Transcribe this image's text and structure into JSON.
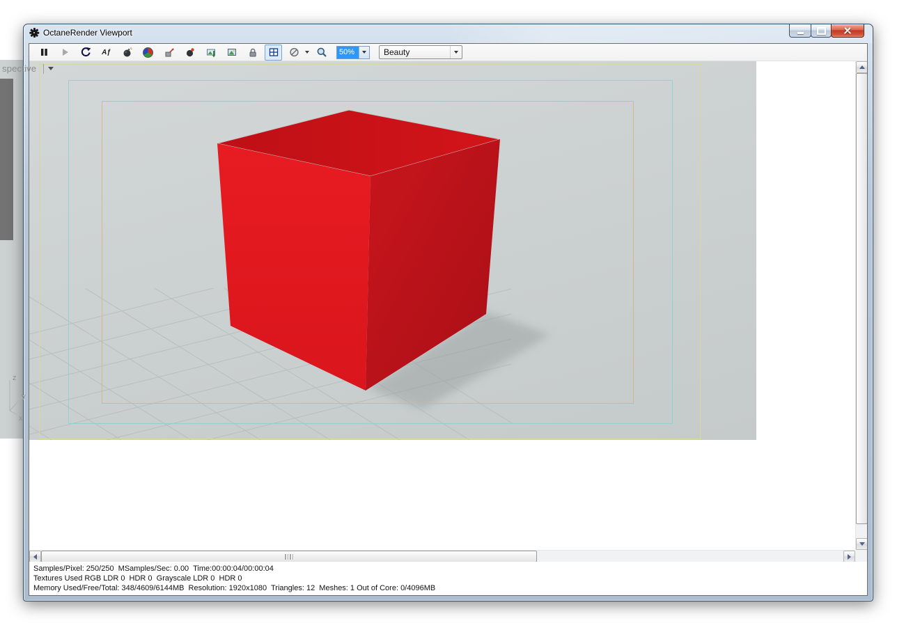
{
  "window": {
    "title": "OctaneRender Viewport"
  },
  "background_app": {
    "viewport_label": "spective",
    "axis_z": "z",
    "axis_y": "y",
    "axis_x": "x"
  },
  "toolbar": {
    "af_icon_label": "Aƒ",
    "zoom_value": "50%",
    "render_pass_value": "Beauty"
  },
  "statusbar": {
    "line1": "Samples/Pixel: 250/250  MSamples/Sec: 0.00  Time:00:00:04/00:00:04",
    "line2": "Textures Used RGB LDR 0  HDR 0  Grayscale LDR 0  HDR 0",
    "line3": "Memory Used/Free/Total: 348/4609/6144MB  Resolution: 1920x1080  Triangles: 12  Meshes: 1 Out of Core: 0/4096MB"
  },
  "colors": {
    "cube_front": "#e2181f",
    "cube_top": "#c51219",
    "cube_right": "#bb1019",
    "frame_outer": "#d9d897",
    "frame_middle": "#8fd2cd",
    "frame_inner": "#d7b57e",
    "selection_blue": "#3096fa",
    "close_button_red": "#c03a24"
  }
}
